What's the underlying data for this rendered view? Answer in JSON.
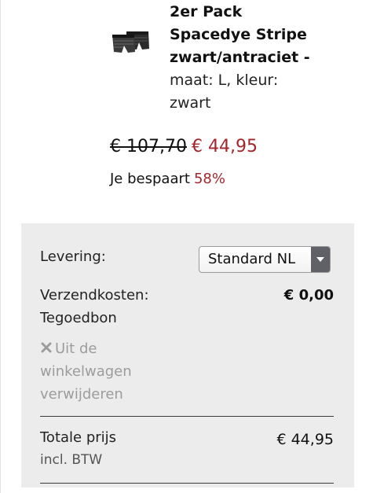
{
  "product": {
    "thumbnail_icon": "boxer-briefs-icon",
    "title_lines": [
      "2er Pack",
      "Spacedye Stripe",
      "zwart/antraciet -"
    ],
    "meta_lines": [
      "maat: L, kleur:",
      "zwart"
    ]
  },
  "pricing": {
    "old_price": "€ 107,70",
    "new_price": "€ 44,95",
    "savings_label": "Je bespaart",
    "savings_percent": "58%"
  },
  "summary": {
    "delivery_label": "Levering:",
    "delivery_selected": "Standard NL",
    "shipping_label": "Verzendkosten:",
    "shipping_value": "€ 0,00",
    "voucher_label": "Tegoedbon",
    "remove_lines": [
      "Uit de",
      "winkelwagen",
      "verwijderen"
    ],
    "total_label": "Totale prijs",
    "total_value": "€ 44,95",
    "vat_label": "incl. BTW"
  },
  "colors": {
    "accent_red": "#a3262b",
    "panel_bg": "#ececec",
    "muted_text": "#9c9c9c"
  }
}
